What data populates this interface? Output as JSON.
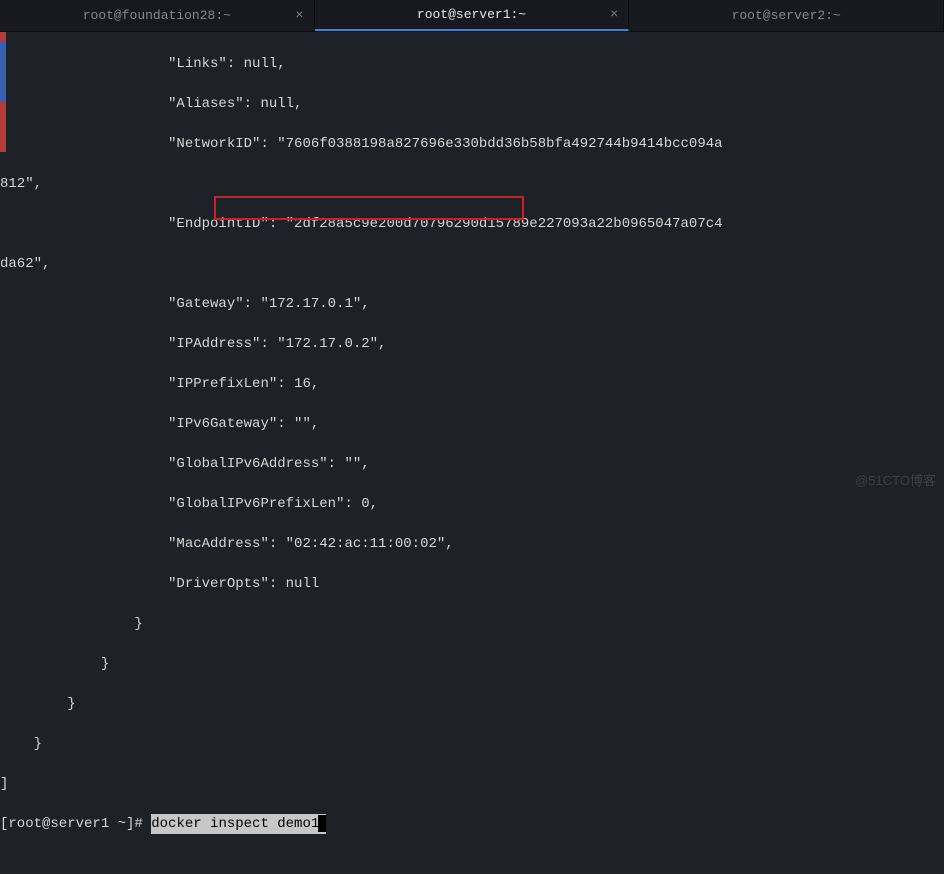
{
  "tabs": [
    {
      "title": "root@foundation28:~",
      "active": false,
      "closable": true
    },
    {
      "title": "root@server1:~",
      "active": true,
      "closable": true
    },
    {
      "title": "root@server2:~",
      "active": false,
      "closable": false
    }
  ],
  "output_lines": [
    "                    \"Links\": null,",
    "                    \"Aliases\": null,",
    "                    \"NetworkID\": \"7606f0388198a827696e330bdd36b58bfa492744b9414bcc094a",
    "812\",",
    "                    \"EndpointID\": \"2df28a5c9e200d70796290d15789e227093a22b0965047a07c4",
    "da62\",",
    "                    \"Gateway\": \"172.17.0.1\",",
    "                    \"IPAddress\": \"172.17.0.2\",",
    "                    \"IPPrefixLen\": 16,",
    "                    \"IPv6Gateway\": \"\",",
    "                    \"GlobalIPv6Address\": \"\",",
    "                    \"GlobalIPv6PrefixLen\": 0,",
    "                    \"MacAddress\": \"02:42:ac:11:00:02\",",
    "                    \"DriverOpts\": null",
    "                }",
    "            }",
    "        }",
    "    }",
    "]"
  ],
  "prompt": "[root@server1 ~]# ",
  "command": "docker inspect demo1",
  "watermark": "@51CTO博客"
}
